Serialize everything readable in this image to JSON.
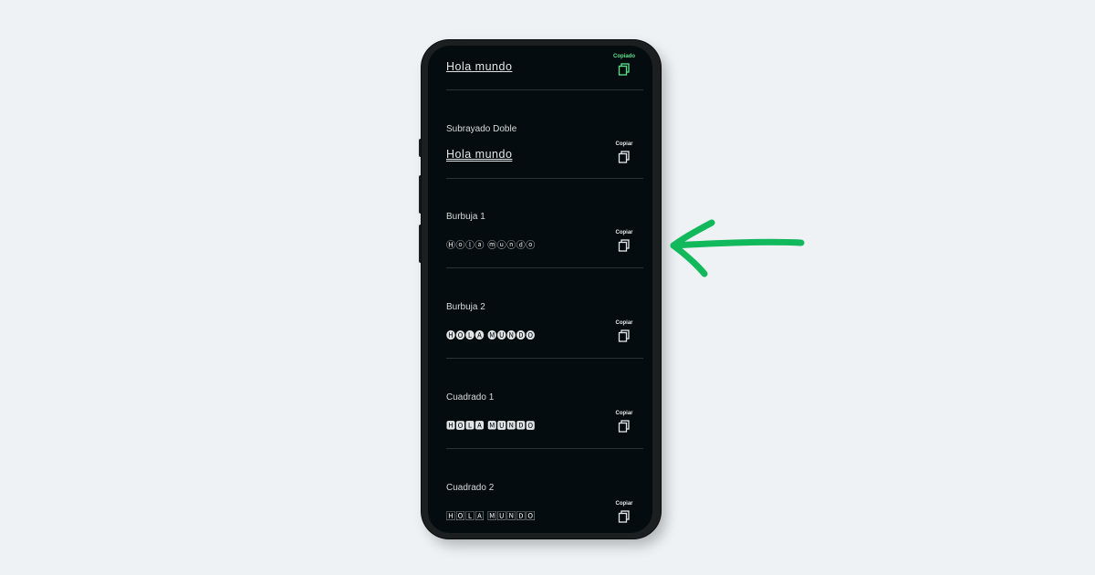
{
  "items": [
    {
      "title": "",
      "sample": "Hola mundo",
      "copy_label": "Copiado",
      "state": "copied"
    },
    {
      "title": "Subrayado Doble",
      "sample": "Hola mundo",
      "copy_label": "Copiar",
      "state": "idle"
    },
    {
      "title": "Burbuja 1",
      "sample": "Ⓗⓞⓛⓐ ⓜⓤⓝⓓⓞ",
      "copy_label": "Copiar",
      "state": "idle"
    },
    {
      "title": "Burbuja 2",
      "sample": "🅗🅞🅛🅐 🅜🅤🅝🅓🅞",
      "copy_label": "Copiar",
      "state": "idle"
    },
    {
      "title": "Cuadrado 1",
      "sample": "🅷🅾🅻🅰 🅼🆄🅽🅳🅾",
      "copy_label": "Copiar",
      "state": "idle"
    },
    {
      "title": "Cuadrado 2",
      "sample": "🄷🄾🄻🄰 🄼🅄🄽🄳🄾",
      "copy_label": "Copiar",
      "state": "idle"
    }
  ],
  "colors": {
    "background": "#eef2f5",
    "screen": "#050c0f",
    "copied": "#5be38a",
    "arrow": "#12b85c"
  },
  "icons": {
    "copy": "copy-icon",
    "arrow": "left-arrow-icon"
  }
}
